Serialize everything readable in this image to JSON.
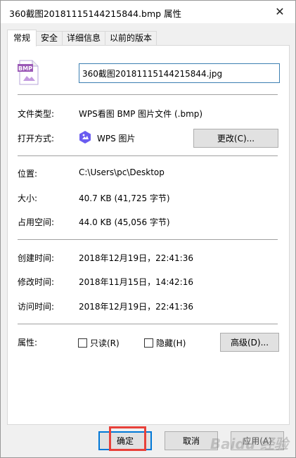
{
  "window": {
    "title": "360截图20181115144215844.bmp 属性",
    "close_glyph": "✕"
  },
  "tabs": [
    {
      "label": "常规",
      "active": true
    },
    {
      "label": "安全",
      "active": false
    },
    {
      "label": "详细信息",
      "active": false
    },
    {
      "label": "以前的版本",
      "active": false
    }
  ],
  "file": {
    "icon_label": "BMP",
    "icon": "bmp-file-icon",
    "name_value": "360截图20181115144215844.jpg"
  },
  "type_section": {
    "file_type_label": "文件类型:",
    "file_type_value": "WPS看图 BMP 图片文件 (.bmp)",
    "open_with_label": "打开方式:",
    "open_with_app": "WPS 图片",
    "open_with_icon": "wps-picture-icon",
    "change_button": "更改(C)..."
  },
  "location_section": {
    "location_label": "位置:",
    "location_value": "C:\\Users\\pc\\Desktop",
    "size_label": "大小:",
    "size_value": "40.7 KB (41,725 字节)",
    "disk_size_label": "占用空间:",
    "disk_size_value": "44.0 KB (45,056 字节)"
  },
  "time_section": {
    "created_label": "创建时间:",
    "created_value": "2018年12月19日，22:41:36",
    "modified_label": "修改时间:",
    "modified_value": "2018年11月15日，14:42:16",
    "accessed_label": "访问时间:",
    "accessed_value": "2018年12月19日，22:41:36"
  },
  "attributes": {
    "label": "属性:",
    "readonly_label": "只读(R)",
    "readonly_checked": false,
    "hidden_label": "隐藏(H)",
    "hidden_checked": false,
    "advanced_button": "高级(D)..."
  },
  "footer": {
    "ok_button": "确定",
    "cancel_button": "取消",
    "apply_button": "应用(A)"
  },
  "watermark": "Baidu 经验",
  "colors": {
    "highlight": "#e8413a",
    "focus_border": "#0078d7",
    "wps_icon": "#6a5cf0",
    "bmp_icon": "#9b59b6"
  }
}
